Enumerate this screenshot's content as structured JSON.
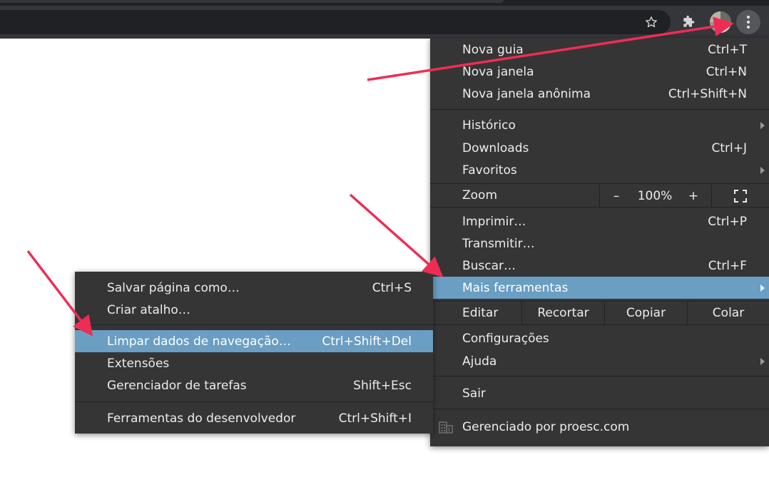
{
  "colors": {
    "accent_highlight": "#6a9ec2",
    "menu_bg": "#353535",
    "annotation_arrow": "#ee2d55"
  },
  "toolbar": {
    "icons": [
      "star-icon",
      "puzzle-icon",
      "avatar",
      "kebab-menu-icon"
    ]
  },
  "main_menu": {
    "nova_guia": {
      "label": "Nova guia",
      "shortcut": "Ctrl+T"
    },
    "nova_janela": {
      "label": "Nova janela",
      "shortcut": "Ctrl+N"
    },
    "nova_janela_anonima": {
      "label": "Nova janela anônima",
      "shortcut": "Ctrl+Shift+N"
    },
    "historico": {
      "label": "Histórico"
    },
    "downloads": {
      "label": "Downloads",
      "shortcut": "Ctrl+J"
    },
    "favoritos": {
      "label": "Favoritos"
    },
    "zoom": {
      "label": "Zoom",
      "minus": "–",
      "level": "100%",
      "plus": "+"
    },
    "imprimir": {
      "label": "Imprimir…",
      "shortcut": "Ctrl+P"
    },
    "transmitir": {
      "label": "Transmitir…"
    },
    "buscar": {
      "label": "Buscar…",
      "shortcut": "Ctrl+F"
    },
    "mais_ferramentas": {
      "label": "Mais ferramentas"
    },
    "editar": {
      "label": "Editar",
      "recortar": "Recortar",
      "copiar": "Copiar",
      "colar": "Colar"
    },
    "configuracoes": {
      "label": "Configurações"
    },
    "ajuda": {
      "label": "Ajuda"
    },
    "sair": {
      "label": "Sair"
    },
    "gerenciado": {
      "label": "Gerenciado por proesc.com"
    }
  },
  "sub_menu": {
    "salvar": {
      "label": "Salvar página como…",
      "shortcut": "Ctrl+S"
    },
    "atalho": {
      "label": "Criar atalho…"
    },
    "limpar": {
      "label": "Limpar dados de navegação…",
      "shortcut": "Ctrl+Shift+Del"
    },
    "extensoes": {
      "label": "Extensões"
    },
    "gerenciador": {
      "label": "Gerenciador de tarefas",
      "shortcut": "Shift+Esc"
    },
    "dev": {
      "label": "Ferramentas do desenvolvedor",
      "shortcut": "Ctrl+Shift+I"
    }
  }
}
